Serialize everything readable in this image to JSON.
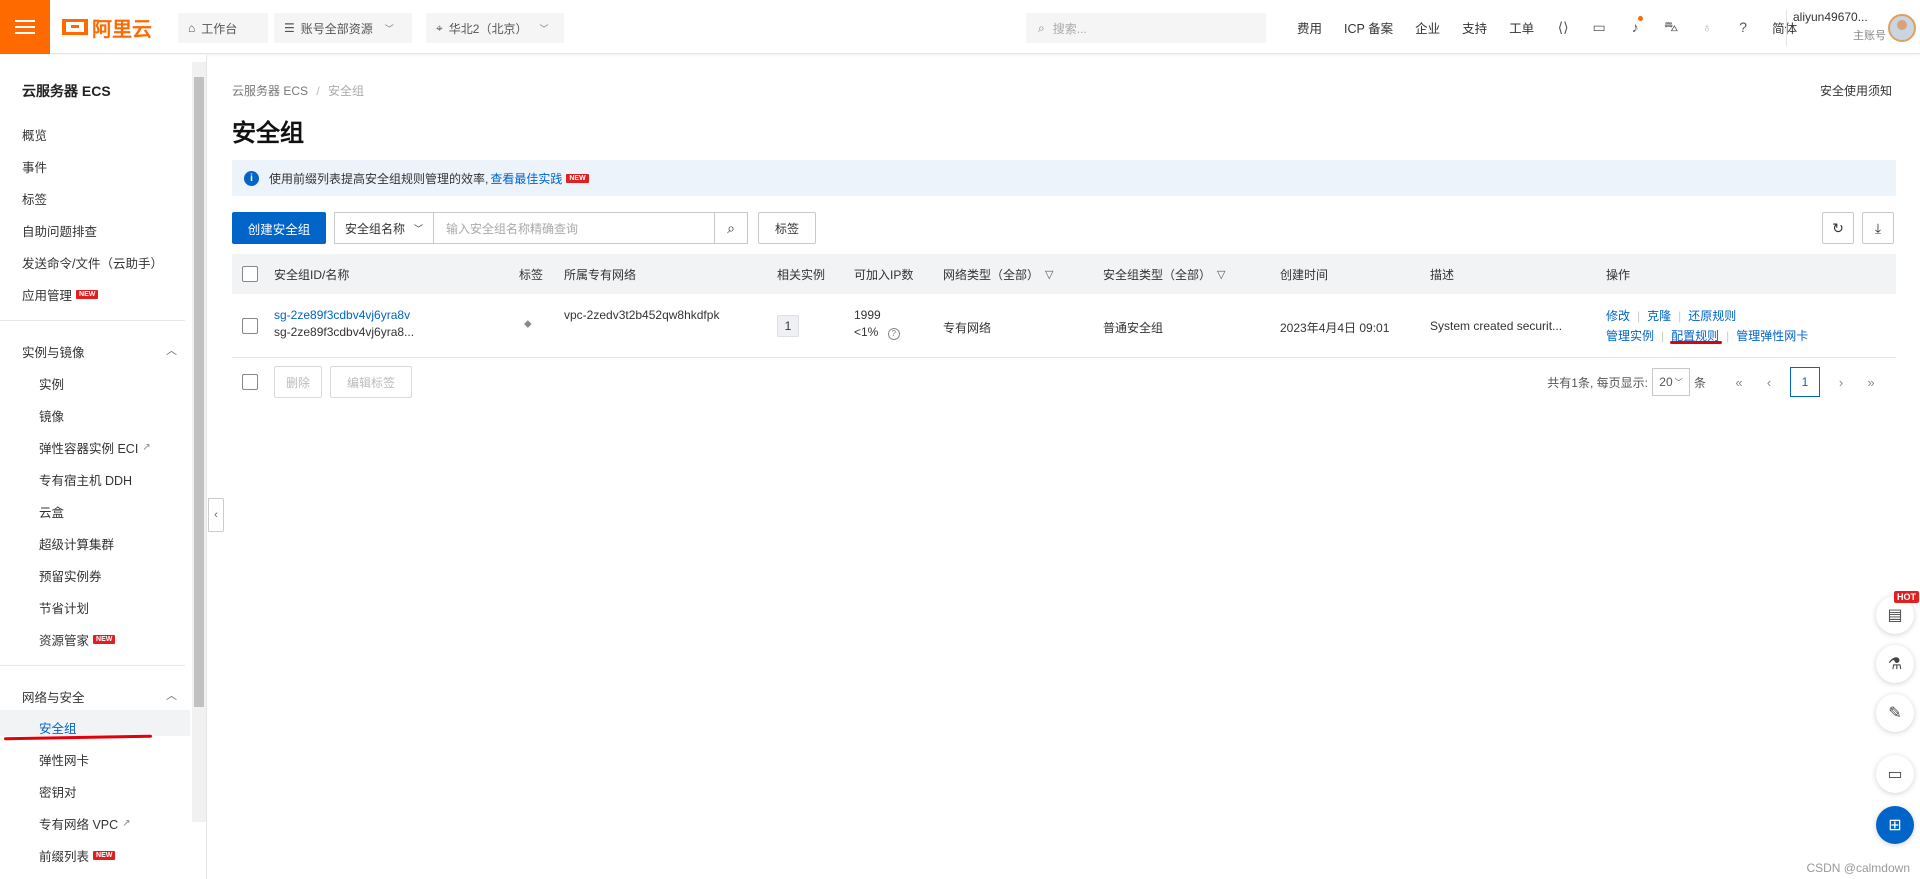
{
  "topbar": {
    "logo_text": "阿里云",
    "workbench": "工作台",
    "resources": "账号全部资源",
    "region": "华北2（北京）",
    "search_placeholder": "搜索...",
    "links": [
      "费用",
      "ICP 备案",
      "企业",
      "支持",
      "工单"
    ],
    "lang": "简体",
    "user_name": "aliyun49670...",
    "user_role": "主账号"
  },
  "sidebar": {
    "title": "云服务器 ECS",
    "top_items": [
      "概览",
      "事件",
      "标签",
      "自助问题排查",
      "发送命令/文件（云助手）",
      "应用管理"
    ],
    "group1": {
      "title": "实例与镜像",
      "items": [
        "实例",
        "镜像",
        "弹性容器实例 ECI",
        "专有宿主机 DDH",
        "云盒",
        "超级计算集群",
        "预留实例券",
        "节省计划",
        "资源管家"
      ]
    },
    "group2": {
      "title": "网络与安全",
      "items": [
        "安全组",
        "弹性网卡",
        "密钥对",
        "专有网络 VPC",
        "前缀列表"
      ]
    },
    "new_badge": "NEW"
  },
  "main": {
    "breadcrumb": [
      "云服务器 ECS",
      "安全组"
    ],
    "crumb_sep": "/",
    "notice_link": "安全使用须知",
    "page_title": "安全组",
    "banner_text": "使用前缀列表提高安全组规则管理的效率,",
    "banner_link": "查看最佳实践",
    "create_button": "创建安全组",
    "filter_select": "安全组名称",
    "search_placeholder": "输入安全组名称精确查询",
    "tag_button": "标签"
  },
  "table": {
    "headers": {
      "id_name": "安全组ID/名称",
      "tags": "标签",
      "vpc": "所属专有网络",
      "instances": "相关实例",
      "ip_count": "可加入IP数",
      "net_type": "网络类型（全部）",
      "sg_type": "安全组类型（全部）",
      "created": "创建时间",
      "desc": "描述",
      "actions": "操作"
    },
    "rows": [
      {
        "id": "sg-2ze89f3cdbv4vj6yra8v",
        "name": "sg-2ze89f3cdbv4vj6yra8...",
        "vpc": "vpc-2zedv3t2b452qw8hkdfpk",
        "instances": "1",
        "ip_count": "1999",
        "ip_pct": "<1%",
        "net_type": "专有网络",
        "sg_type": "普通安全组",
        "created": "2023年4月4日 09:01",
        "desc": "System created securit...",
        "actions": {
          "modify": "修改",
          "clone": "克隆",
          "restore": "还原规则",
          "manage_instances": "管理实例",
          "configure_rules": "配置规则",
          "manage_eni": "管理弹性网卡"
        }
      }
    ]
  },
  "footer": {
    "delete": "删除",
    "edit_tags": "编辑标签",
    "total_text": "共有1条, 每页显示:",
    "page_size": "20",
    "unit": "条",
    "current_page": "1"
  },
  "float_hot": "HOT",
  "watermark": "CSDN @calmdown"
}
